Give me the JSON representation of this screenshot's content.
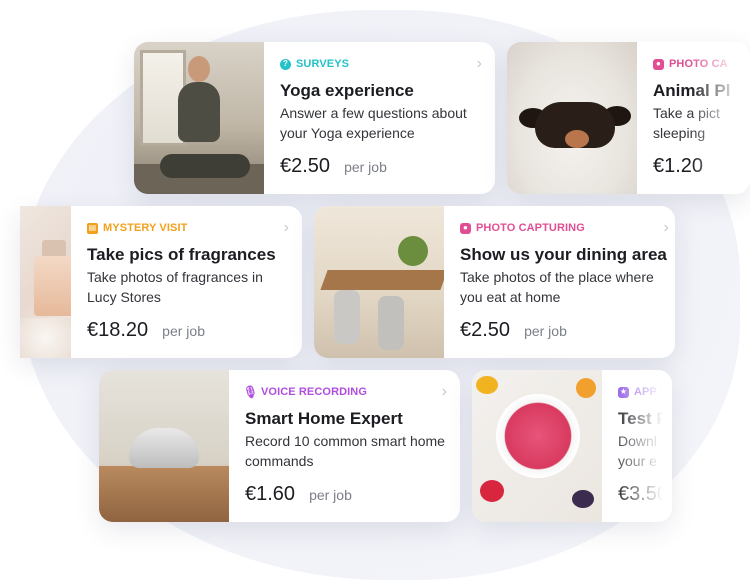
{
  "colors": {
    "surveys": "#22c3c9",
    "photo": "#e04f94",
    "mystery": "#f1a11c",
    "voice": "#b04ee0",
    "app": "#8d55e3"
  },
  "cards": [
    {
      "id": "yoga",
      "category": "SURVEYS",
      "category_icon": "help-circle-icon",
      "title": "Yoga experience",
      "description": "Answer a few questions about your Yoga experience",
      "price": "€2.50",
      "per": "per job"
    },
    {
      "id": "animal",
      "category": "PHOTO CA",
      "category_icon": "camera-icon",
      "title": "Animal Pl",
      "description": "Take a pict sleeping",
      "price": "€1.20",
      "per": ""
    },
    {
      "id": "fragrances",
      "category": "MYSTERY VISIT",
      "category_icon": "store-icon",
      "title": "Take pics of fragrances",
      "description": "Take photos of fragrances in Lucy Stores",
      "price": "€18.20",
      "per": "per job"
    },
    {
      "id": "dining",
      "category": "PHOTO CAPTURING",
      "category_icon": "camera-icon",
      "title": "Show us your dining area",
      "description": "Take photos of the place where you eat at home",
      "price": "€2.50",
      "per": "per job"
    },
    {
      "id": "smarthome",
      "category": "VOICE RECORDING",
      "category_icon": "microphone-icon",
      "title": "Smart Home Expert",
      "description": "Record 10 common smart home commands",
      "price": "€1.60",
      "per": "per job"
    },
    {
      "id": "app",
      "category": "APP T",
      "category_icon": "app-icon",
      "title": "Test F",
      "description": "Downl your e",
      "price": "€3.50",
      "per": ""
    }
  ]
}
